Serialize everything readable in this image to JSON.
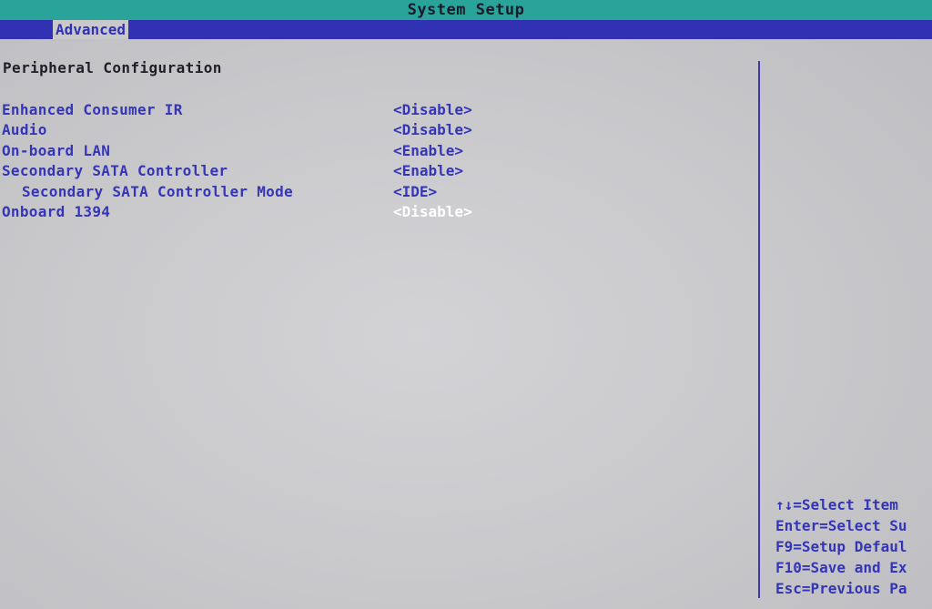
{
  "window": {
    "title": "System Setup"
  },
  "menu": {
    "active_tab": "Advanced"
  },
  "section": {
    "title": "Peripheral Configuration"
  },
  "settings": [
    {
      "label": "Enhanced Consumer IR",
      "value": "<Disable>",
      "indent": false,
      "selected": false
    },
    {
      "label": "Audio",
      "value": "<Disable>",
      "indent": false,
      "selected": false
    },
    {
      "label": "On-board LAN",
      "value": "<Enable>",
      "indent": false,
      "selected": false
    },
    {
      "label": "Secondary SATA Controller",
      "value": "<Enable>",
      "indent": false,
      "selected": false
    },
    {
      "label": "Secondary SATA Controller Mode",
      "value": "<IDE>",
      "indent": true,
      "selected": false
    },
    {
      "label": "Onboard 1394",
      "value": "<Disable>",
      "indent": false,
      "selected": true
    }
  ],
  "help": {
    "keys": [
      "↑↓=Select Item",
      "Enter=Select Su",
      "F9=Setup Defaul",
      "F10=Save and Ex",
      "Esc=Previous Pa"
    ]
  },
  "colors": {
    "title_bar": "#2aa39a",
    "menu_bar": "#3131b3",
    "background": "#c9c9cc",
    "text_blue": "#3535b8",
    "selected_text": "#ffffff"
  }
}
